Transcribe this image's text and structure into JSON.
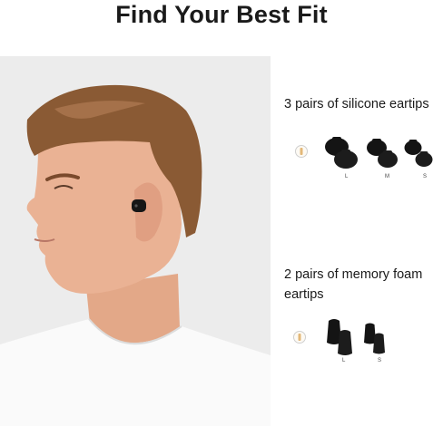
{
  "title": "Find Your Best Fit",
  "silicone": {
    "label": "3 pairs of silicone eartips",
    "sizes": [
      "L",
      "M",
      "S"
    ]
  },
  "foam": {
    "label": "2 pairs of memory foam eartips",
    "sizes": [
      "L",
      "S"
    ]
  },
  "colors": {
    "background": "#ffffff",
    "photo_background": "#ececec",
    "eartip": "#141414",
    "nozzle": "#e3b878",
    "skin": "#eab294",
    "hair": "#8a5a34",
    "shirt": "#fafafa"
  },
  "icons": {
    "size_indicator": "size-indicator-icon",
    "eartip": "eartip-icon",
    "earbud": "earbud-icon"
  }
}
